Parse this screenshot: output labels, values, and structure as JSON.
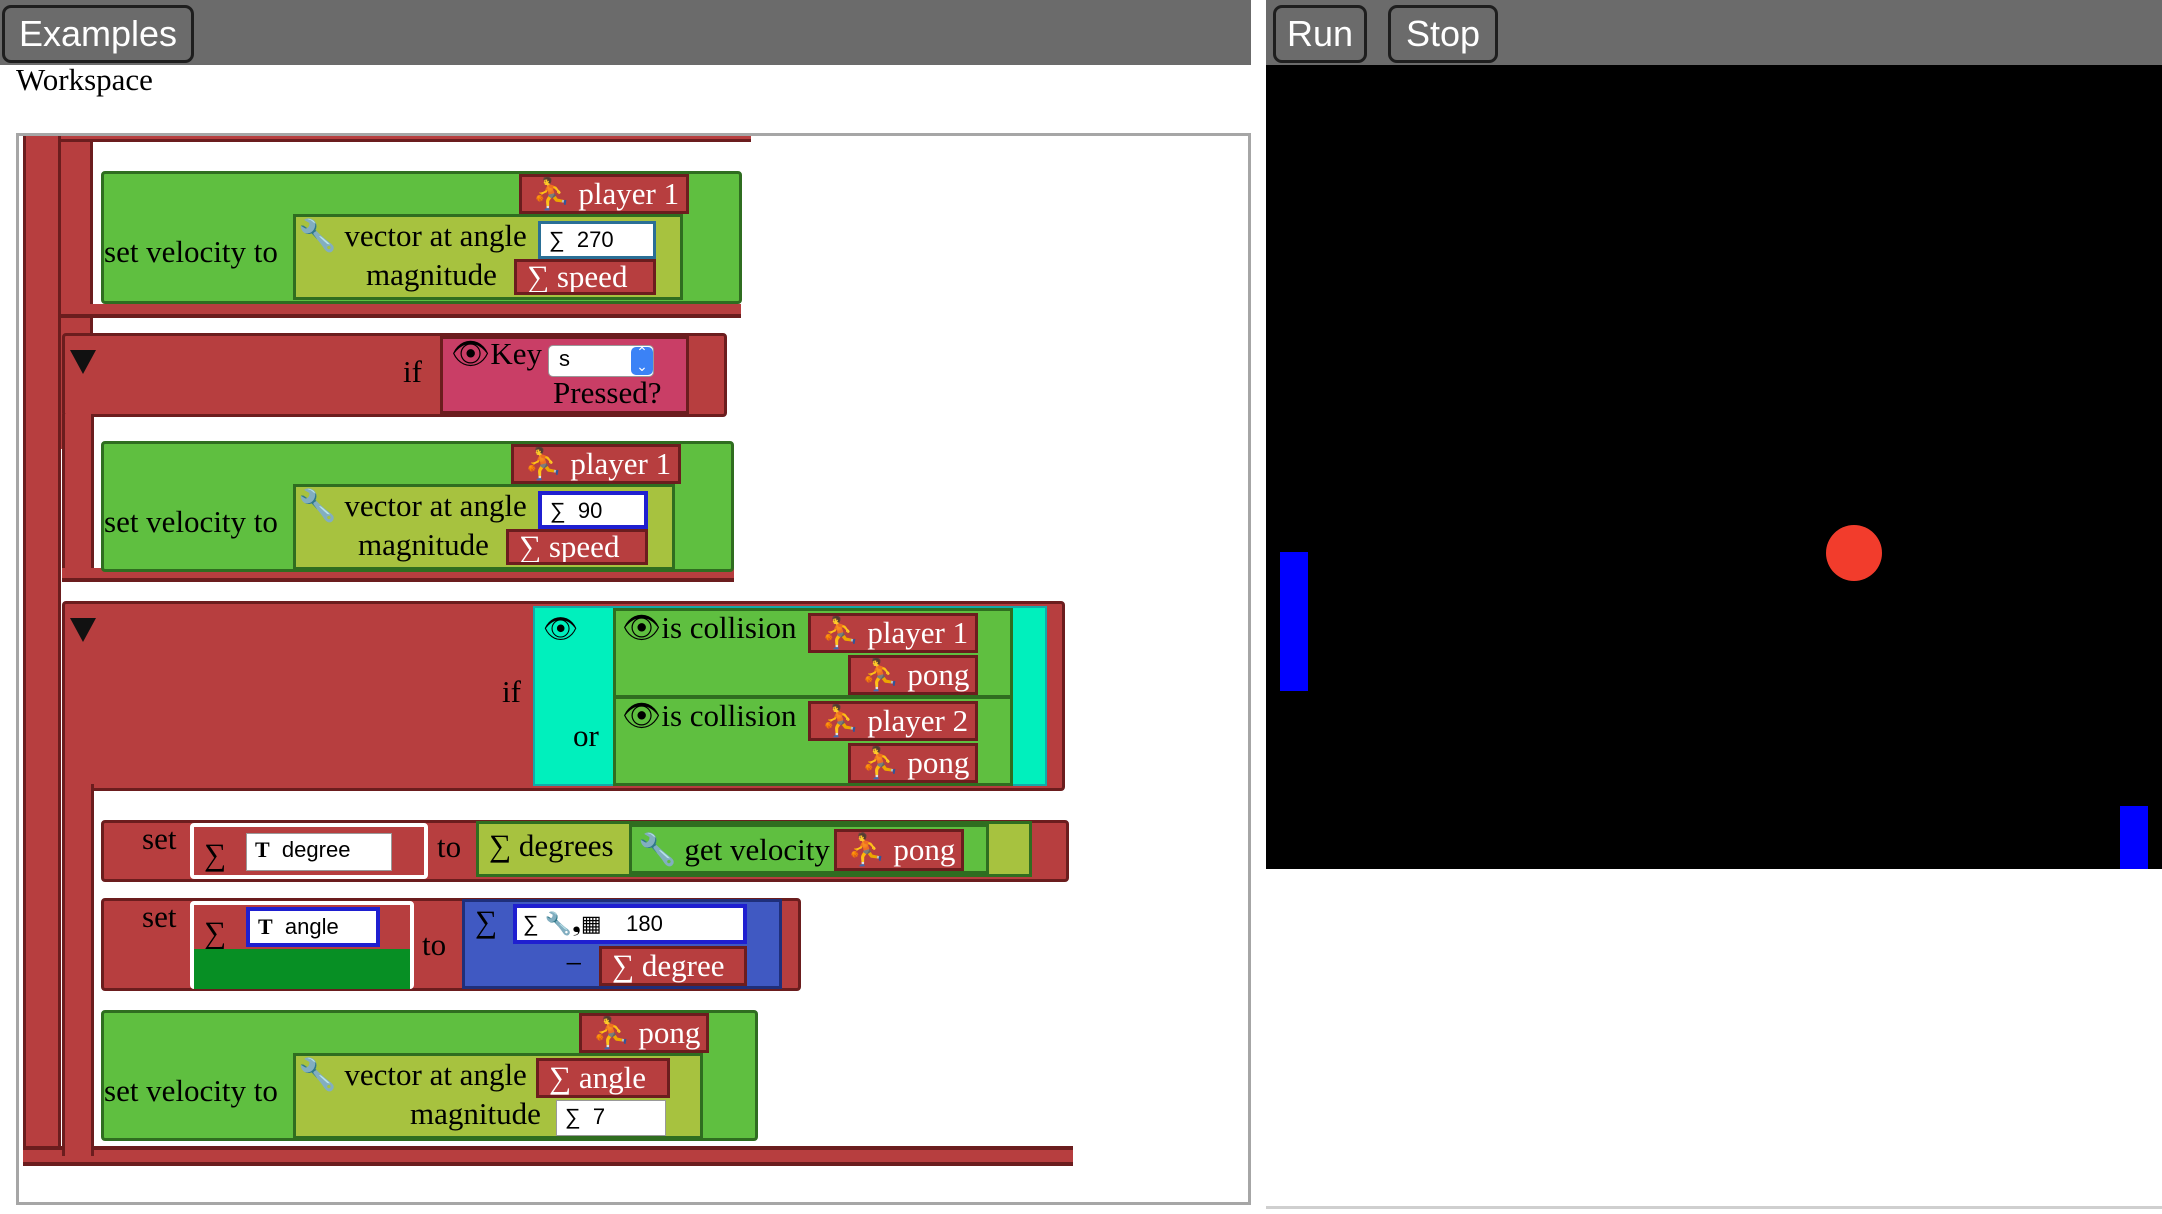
{
  "toolbar": {
    "examples_label": "Examples",
    "run_label": "Run",
    "stop_label": "Stop"
  },
  "workspace": {
    "title": "Workspace"
  },
  "blocks": {
    "set_velocity_label": "set velocity to",
    "vector_at_angle_label": "vector at angle",
    "magnitude_label": "magnitude",
    "if_label": "if",
    "or_label": "or",
    "set_label": "set",
    "to_label": "to",
    "minus_label": "−",
    "sigma": "∑",
    "text_T": "T",
    "block1": {
      "sprite": "player 1",
      "angle": "270",
      "magnitude": "speed"
    },
    "key_cond": {
      "key_label": "Key",
      "key_value": "s",
      "pressed_label": "Pressed?"
    },
    "block2": {
      "sprite": "player 1",
      "angle": "90",
      "magnitude": "speed"
    },
    "collision": {
      "is_collision_label": "is collision",
      "a1": "player 1",
      "b1": "pong",
      "a2": "player 2",
      "b2": "pong"
    },
    "set_degree": {
      "var": "degree",
      "degrees_label": "degrees",
      "get_velocity_label": "get velocity",
      "sprite": "pong"
    },
    "set_angle": {
      "var": "angle",
      "value": "180",
      "subtract": "degree"
    },
    "block3": {
      "sprite": "pong",
      "angle": "angle",
      "magnitude": "7"
    }
  },
  "stage": {
    "background": "#000000",
    "paddle_color": "#0000ff",
    "ball_color": "#f23c2c"
  }
}
